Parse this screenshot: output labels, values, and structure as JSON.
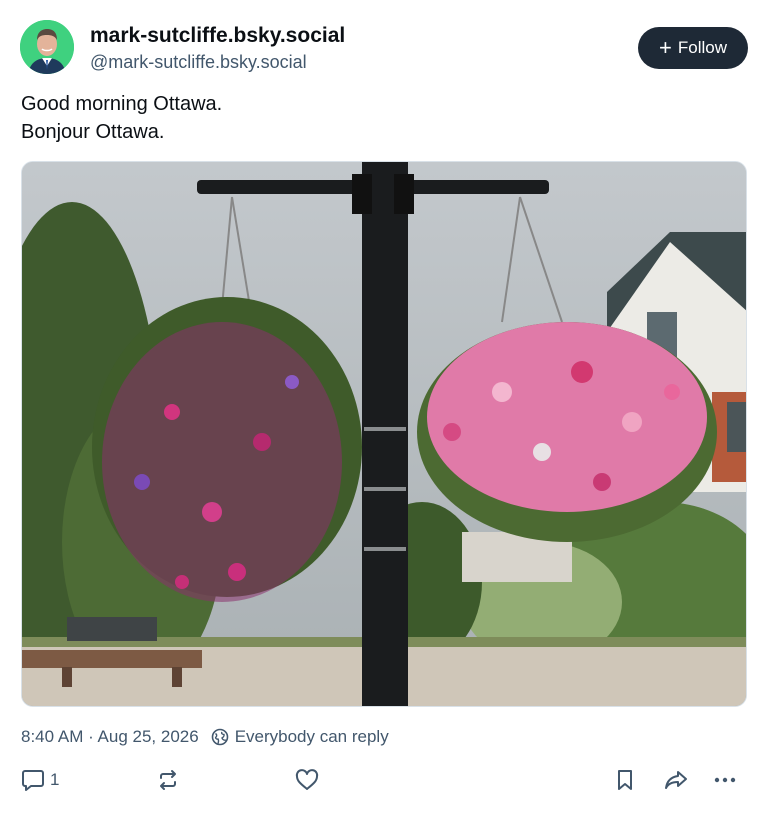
{
  "author": {
    "display_name": "mark-sutcliffe.bsky.social",
    "handle": "@mark-sutcliffe.bsky.social",
    "avatar_icon": "avatar-photo",
    "avatar_bg": "#3fd17f"
  },
  "follow_button": {
    "icon": "plus-icon",
    "label": "Follow",
    "bg": "#1e2936"
  },
  "post": {
    "lines": [
      "Good morning Ottawa.",
      "Bonjour Ottawa."
    ]
  },
  "media": {
    "description_icon": "photo-hanging-flower-baskets"
  },
  "meta": {
    "timestamp": "8:40 AM · Aug 25, 2026",
    "reply_setting": "Everybody can reply",
    "reply_setting_icon": "globe-icon"
  },
  "actions": {
    "reply_count": "1",
    "reply_icon": "comment-icon",
    "repost_icon": "repost-icon",
    "like_icon": "heart-icon",
    "bookmark_icon": "bookmark-icon",
    "share_icon": "share-icon",
    "more_icon": "more-icon"
  },
  "colors": {
    "text_primary": "#0b0f14",
    "text_secondary": "#42576c",
    "button_dark": "#1e2936"
  }
}
